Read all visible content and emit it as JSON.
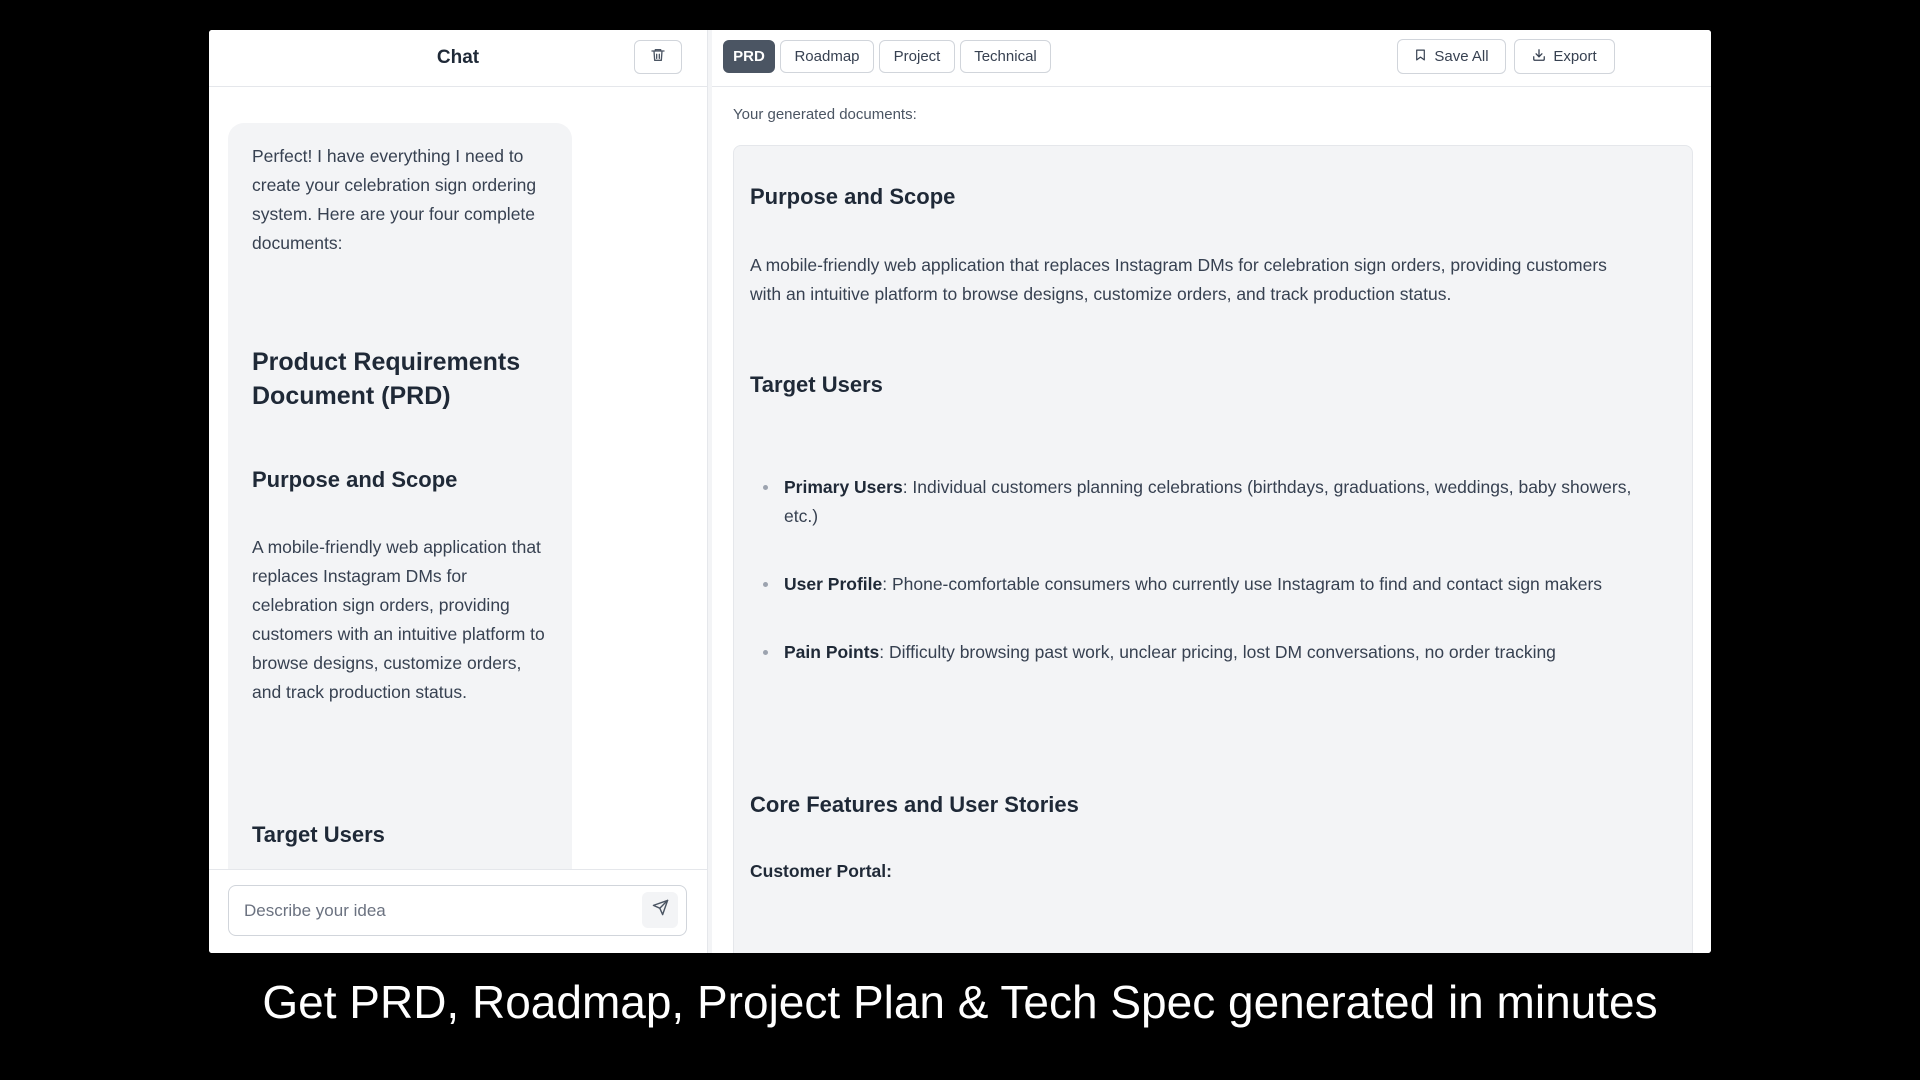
{
  "chat": {
    "title": "Chat",
    "message": {
      "intro": "Perfect! I have everything I need to create your celebration sign ordering system. Here are your four complete documents:",
      "heading": "Product Requirements Document (PRD)",
      "purpose_heading": "Purpose and Scope",
      "purpose_text": "A mobile-friendly web application that replaces Instagram DMs for celebration sign orders, providing customers with an intuitive platform to browse designs, customize orders, and track production status.",
      "target_heading": "Target Users"
    },
    "input": {
      "placeholder": "Describe your idea"
    }
  },
  "docs": {
    "tabs": [
      {
        "label": "PRD",
        "active": true
      },
      {
        "label": "Roadmap",
        "active": false
      },
      {
        "label": "Project",
        "active": false
      },
      {
        "label": "Technical",
        "active": false
      }
    ],
    "save_label": "Save All",
    "export_label": "Export",
    "caption": "Your generated documents:",
    "content": {
      "purpose_heading": "Purpose and Scope",
      "purpose_text": "A mobile-friendly web application that replaces Instagram DMs for celebration sign orders, providing customers with an intuitive platform to browse designs, customize orders, and track production status.",
      "target_heading": "Target Users",
      "bullets": [
        {
          "term": "Primary Users",
          "text": ": Individual customers planning celebrations (birthdays, graduations, weddings, baby showers, etc.)"
        },
        {
          "term": "User Profile",
          "text": ": Phone-comfortable consumers who currently use Instagram to find and contact sign makers"
        },
        {
          "term": "Pain Points",
          "text": ": Difficulty browsing past work, unclear pricing, lost DM conversations, no order tracking"
        }
      ],
      "core_heading": "Core Features and User Stories",
      "portal_label": "Customer Portal:"
    }
  },
  "marketing_caption": "Get PRD, Roadmap, Project Plan & Tech Spec generated in minutes",
  "icons": {
    "trash": "trash-icon",
    "send": "send-icon",
    "bookmark": "bookmark-icon",
    "download": "download-icon"
  },
  "colors": {
    "active_tab": "#4b5563",
    "panel_bg": "#f3f4f6",
    "border": "#d1d5db",
    "text": "#374151",
    "heading": "#1f2937"
  }
}
